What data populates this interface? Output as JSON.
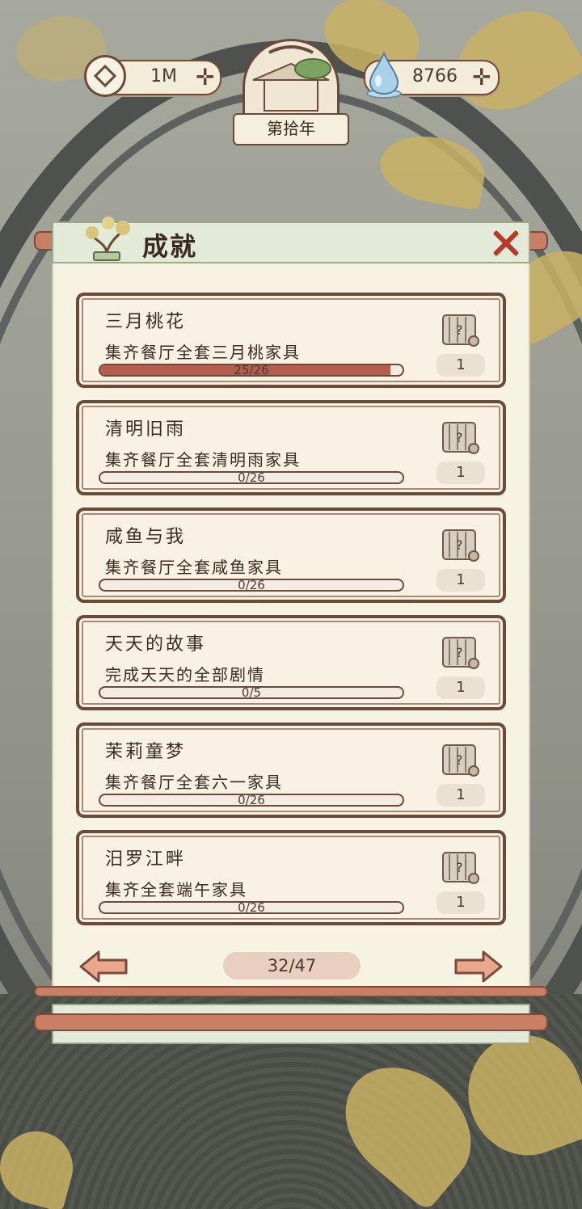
{
  "hud": {
    "coins": "1M",
    "water_drops": "8766",
    "year": "第拾年"
  },
  "panel": {
    "title": "成就",
    "achievements": [
      {
        "title": "三月桃花",
        "description": "集齐餐厅全套三月桃家具",
        "progress_text": "25/26",
        "progress": 0.96,
        "reward_count": "1"
      },
      {
        "title": "清明旧雨",
        "description": "集齐餐厅全套清明雨家具",
        "progress_text": "0/26",
        "progress": 0,
        "reward_count": "1"
      },
      {
        "title": "咸鱼与我",
        "description": "集齐餐厅全套咸鱼家具",
        "progress_text": "0/26",
        "progress": 0,
        "reward_count": "1"
      },
      {
        "title": "天天的故事",
        "description": "完成天天的全部剧情",
        "progress_text": "0/5",
        "progress": 0,
        "reward_count": "1"
      },
      {
        "title": "茉莉童梦",
        "description": "集齐餐厅全套六一家具",
        "progress_text": "0/26",
        "progress": 0,
        "reward_count": "1"
      },
      {
        "title": "汨罗江畔",
        "description": "集齐全套端午家具",
        "progress_text": "0/26",
        "progress": 0,
        "reward_count": "1"
      }
    ],
    "pagination": "32/47"
  },
  "colors": {
    "accent_red": "#b53a2c",
    "progress_fill": "#b45e4e",
    "frame_brown": "#6b4a3a",
    "card_bg": "#f8f1e4"
  },
  "icons": {
    "coin": "coin-icon",
    "water_drop": "water-drop-icon",
    "close": "close-icon",
    "reward": "mystery-scroll-icon",
    "prev": "arrow-left-icon",
    "next": "arrow-right-icon"
  }
}
